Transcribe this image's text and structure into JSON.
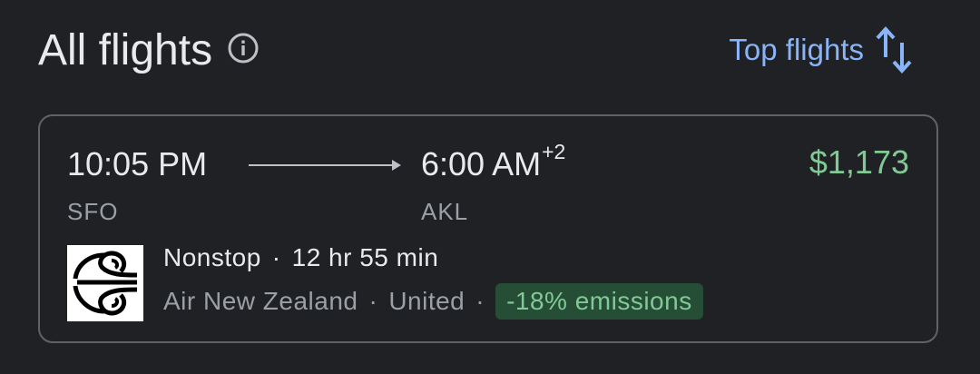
{
  "header": {
    "title": "All flights",
    "sort_label": "Top flights"
  },
  "flight": {
    "depart_time": "10:05 PM",
    "arrive_time": "6:00 AM",
    "arrive_day_offset": "+2",
    "origin": "SFO",
    "destination": "AKL",
    "price": "$1,173",
    "stops": "Nonstop",
    "separator": "·",
    "duration": "12 hr 55 min",
    "airline_1": "Air New Zealand",
    "airline_2": "United",
    "emissions": "-18% emissions"
  },
  "colors": {
    "background": "#202124",
    "accent_blue": "#8ab4f8",
    "price_green": "#81c995",
    "emissions_bg": "#264d36"
  },
  "icons": {
    "info": "info-icon",
    "sort": "sort-arrows-icon",
    "flight_arrow": "arrow-right-icon",
    "airline_logo": "air-new-zealand-koru-logo"
  }
}
